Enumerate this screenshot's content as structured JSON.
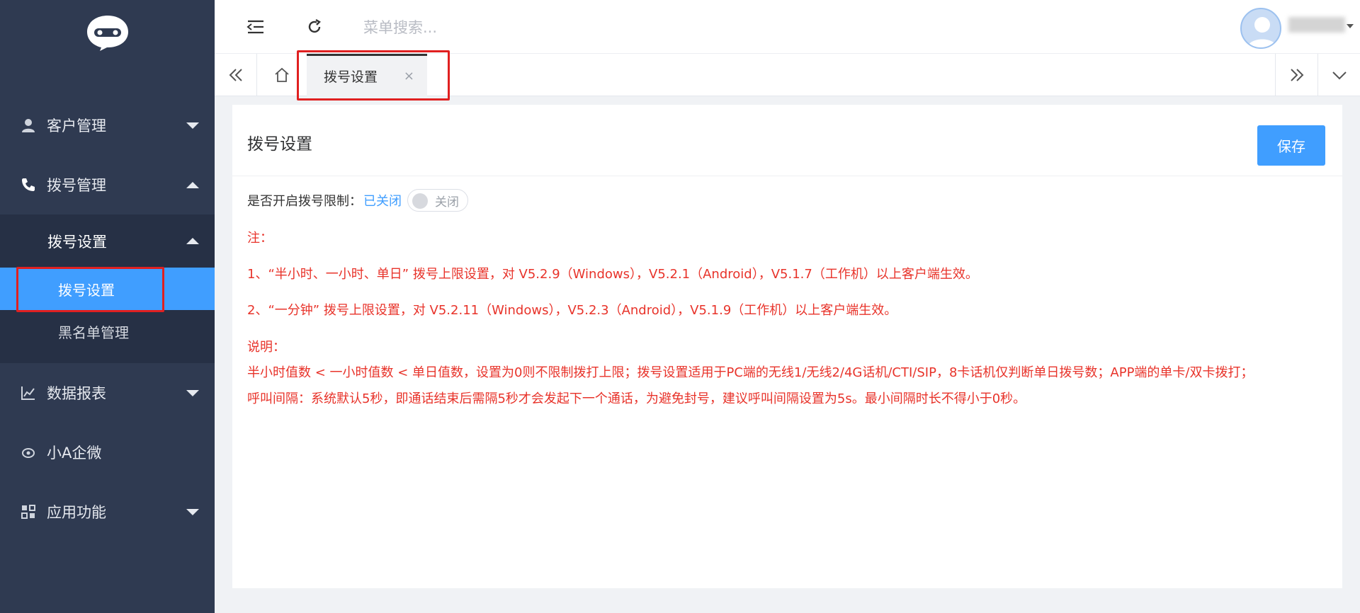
{
  "sidebar": {
    "menu": [
      {
        "label": "客户管理",
        "icon": "user-icon"
      },
      {
        "label": "拨号管理",
        "icon": "phone-icon"
      },
      {
        "label": "数据报表",
        "icon": "chart-icon"
      },
      {
        "label": "小A企微",
        "icon": "eye-icon"
      },
      {
        "label": "应用功能",
        "icon": "apps-icon"
      }
    ],
    "submenu": {
      "header": "拨号设置",
      "items": [
        "拨号设置",
        "黑名单管理"
      ]
    }
  },
  "topbar": {
    "search_placeholder": "菜单搜索..."
  },
  "tabs": {
    "active_label": "拨号设置",
    "close_glyph": "×"
  },
  "content": {
    "title": "拨号设置",
    "save_label": "保存",
    "limit_label": "是否开启拨号限制：",
    "limit_status": "已关闭",
    "switch_text": "关闭",
    "switch_on": false,
    "note_title": "注：",
    "note_1": "1、“半小时、一小时、单日” 拨号上限设置，对 V5.2.9（Windows），V5.2.1（Android），V5.1.7（工作机）以上客户端生效。",
    "note_2": "2、“一分钟” 拨号上限设置，对 V5.2.11（Windows），V5.2.3（Android），V5.1.9（工作机）以上客户端生效。",
    "explain_title": "说明：",
    "explain_1": "半小时值数 < 一小时值数 < 单日值数，设置为0则不限制拨打上限；拨号设置适用于PC端的无线1/无线2/4G话机/CTI/SIP，8卡话机仅判断单日拨号数；APP端的单卡/双卡拨打；",
    "explain_2": "呼叫间隔：系统默认5秒，即通话结束后需隔5秒才会发起下一个通话，为避免封号，建议呼叫间隔设置为5s。最小间隔时长不得小于0秒。"
  },
  "colors": {
    "sidebar_bg": "#2f3a51",
    "submenu_bg": "#263045",
    "accent": "#409eff",
    "note_red": "#e8332a",
    "highlight_box": "#e02020"
  }
}
